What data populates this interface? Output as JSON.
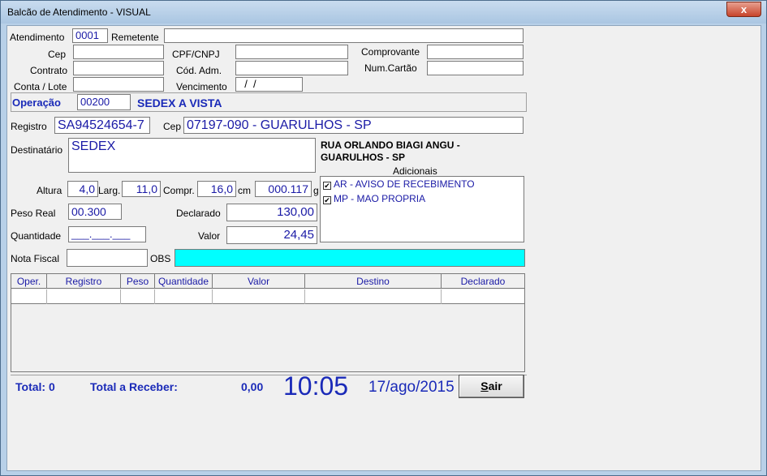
{
  "window": {
    "title": "Balcão de Atendimento - VISUAL",
    "close": "x"
  },
  "form": {
    "atendimento_label": "Atendimento",
    "atendimento": "0001",
    "remetente_label": "Remetente",
    "remetente": "",
    "cep_label": "Cep",
    "cep": "",
    "cpf_label": "CPF/CNPJ",
    "cpf": "",
    "comprovante_label": "Comprovante",
    "comprovante": "",
    "contrato_label": "Contrato",
    "contrato": "",
    "codadm_label": "Cód. Adm.",
    "codadm": "",
    "numcartao_label": "Num.Cartão",
    "numcartao": "",
    "contalote_label": "Conta / Lote",
    "contalote": "",
    "vencimento_label": "Vencimento",
    "vencimento": "  /  /",
    "operacao_label": "Operação",
    "operacao_code": "00200",
    "operacao_name": "SEDEX A VISTA",
    "registro_label": "Registro",
    "registro": "SA94524654-7",
    "cep2_label": "Cep",
    "cep2": "07197-090 - GUARULHOS - SP",
    "destinatario_label": "Destinatário",
    "destinatario": "SEDEX",
    "address_line1": "RUA ORLANDO BIAGI ANGU -",
    "address_line2": "GUARULHOS - SP",
    "adicionais_label": "Adicionais",
    "adicionais": [
      "AR - AVISO DE RECEBIMENTO",
      "MP - MAO PROPRIA"
    ],
    "check_mark": "✔",
    "altura_label": "Altura",
    "altura": "4,0",
    "largura_label": "Larg.",
    "largura": "11,0",
    "compr_label": "Compr.",
    "compr": "16,0",
    "cm_label": "cm",
    "volume": "000.117",
    "g_label": "g",
    "pesoreal_label": "Peso Real",
    "pesoreal": "00.300",
    "declarado_label": "Declarado",
    "declarado": "130,00",
    "quantidade_label": "Quantidade",
    "quantidade": "___.___.___",
    "valor_label": "Valor",
    "valor": "24,45",
    "notafiscal_label": "Nota Fiscal",
    "notafiscal": "",
    "obs_label": "OBS",
    "obs": ""
  },
  "grid": {
    "columns": [
      "Oper.",
      "Registro",
      "Peso",
      "Quantidade",
      "Valor",
      "Destino",
      "Declarado"
    ]
  },
  "footer": {
    "total": "Total: 0",
    "total_receber_label": "Total a Receber:",
    "total_receber": "0,00",
    "time": "10:05",
    "date": "17/ago/2015",
    "sair_first": "S",
    "sair_rest": "air"
  },
  "colors": {
    "obs_bg": "#00ffff",
    "label_blue": "#1a2ab8",
    "value_blue": "#1a1aa6"
  }
}
